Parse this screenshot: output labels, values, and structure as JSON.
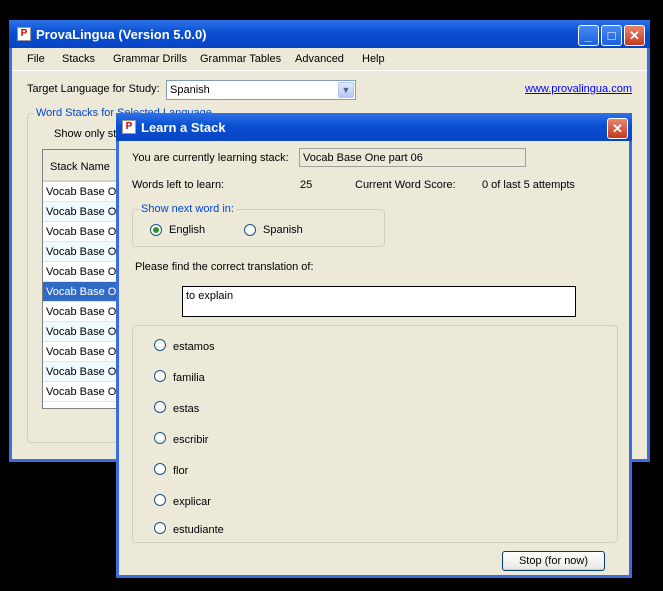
{
  "main_window": {
    "title": "ProvaLingua (Version 5.0.0)",
    "icon": "provalingua-app-icon",
    "menu": [
      "File",
      "Stacks",
      "Grammar Drills",
      "Grammar Tables",
      "Advanced",
      "Help"
    ],
    "target_language_label": "Target Language for Study:",
    "target_language_value": "Spanish",
    "website_link": "www.provalingua.com",
    "word_stacks_group": "Word Stacks for Selected Language",
    "show_only_label": "Show only sta",
    "stack_name_header": "Stack Name",
    "stack_rows": [
      "Vocab Base On",
      "Vocab Base On",
      "Vocab Base On",
      "Vocab Base On",
      "Vocab Base On",
      "Vocab Base On",
      "Vocab Base On",
      "Vocab Base On",
      "Vocab Base On",
      "Vocab Base On",
      "Vocab Base On"
    ],
    "selected_row_index": 5
  },
  "dialog": {
    "title": "Learn a Stack",
    "currently_learning_label": "You are currently learning stack:",
    "currently_learning_value": "Vocab Base One part 06",
    "words_left_label": "Words left to learn:",
    "words_left_value": "25",
    "current_score_label": "Current Word Score:",
    "current_score_value": "0 of last 5 attempts",
    "show_next_group": "Show next word in:",
    "lang_options": [
      {
        "label": "English",
        "checked": true
      },
      {
        "label": "Spanish",
        "checked": false
      }
    ],
    "prompt_label": "Please find the correct translation of:",
    "prompt_word": "to explain",
    "answers": [
      "estamos",
      "familia",
      "estas",
      "escribir",
      "flor",
      "explicar",
      "estudiante"
    ],
    "stop_button": "Stop (for now)"
  },
  "colors": {
    "title_blue": "#0a4fd1",
    "selection": "#316ac5",
    "link": "#0000ff",
    "group_label": "#0046d5"
  }
}
